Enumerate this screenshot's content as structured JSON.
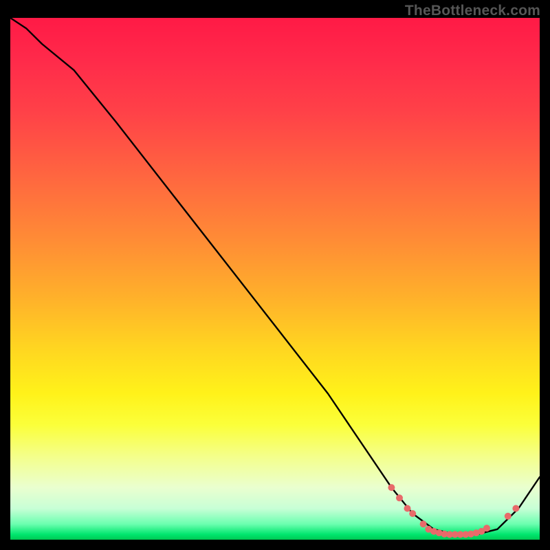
{
  "watermark": "TheBottleneck.com",
  "chart_data": {
    "type": "line",
    "title": "",
    "xlabel": "",
    "ylabel": "",
    "xlim": [
      0,
      100
    ],
    "ylim": [
      0,
      100
    ],
    "note": "Bottleneck curve: descends from top-left, reaches a flat minimum near x≈78–90, then rises toward the right edge. Coral dot markers sit on the curve around the minimum region.",
    "series": [
      {
        "name": "bottleneck-curve",
        "x": [
          0,
          3,
          6,
          12,
          20,
          30,
          40,
          50,
          60,
          68,
          72,
          76,
          80,
          84,
          88,
          92,
          96,
          100
        ],
        "y": [
          100,
          98,
          95,
          90,
          80,
          67,
          54,
          41,
          28,
          16,
          10,
          5,
          2,
          1,
          1,
          2,
          6,
          12
        ]
      }
    ],
    "markers": {
      "name": "highlight-dots",
      "color": "#e86a6a",
      "points": [
        {
          "x": 72,
          "y": 10
        },
        {
          "x": 73.5,
          "y": 8
        },
        {
          "x": 75,
          "y": 6
        },
        {
          "x": 76,
          "y": 5
        },
        {
          "x": 78,
          "y": 3
        },
        {
          "x": 79,
          "y": 2
        },
        {
          "x": 80,
          "y": 1.6
        },
        {
          "x": 81,
          "y": 1.3
        },
        {
          "x": 82,
          "y": 1.1
        },
        {
          "x": 83,
          "y": 1
        },
        {
          "x": 84,
          "y": 1
        },
        {
          "x": 85,
          "y": 1
        },
        {
          "x": 86,
          "y": 1
        },
        {
          "x": 87,
          "y": 1.1
        },
        {
          "x": 88,
          "y": 1.3
        },
        {
          "x": 89,
          "y": 1.6
        },
        {
          "x": 90,
          "y": 2.2
        },
        {
          "x": 94,
          "y": 4.5
        },
        {
          "x": 95.5,
          "y": 6
        }
      ]
    }
  }
}
